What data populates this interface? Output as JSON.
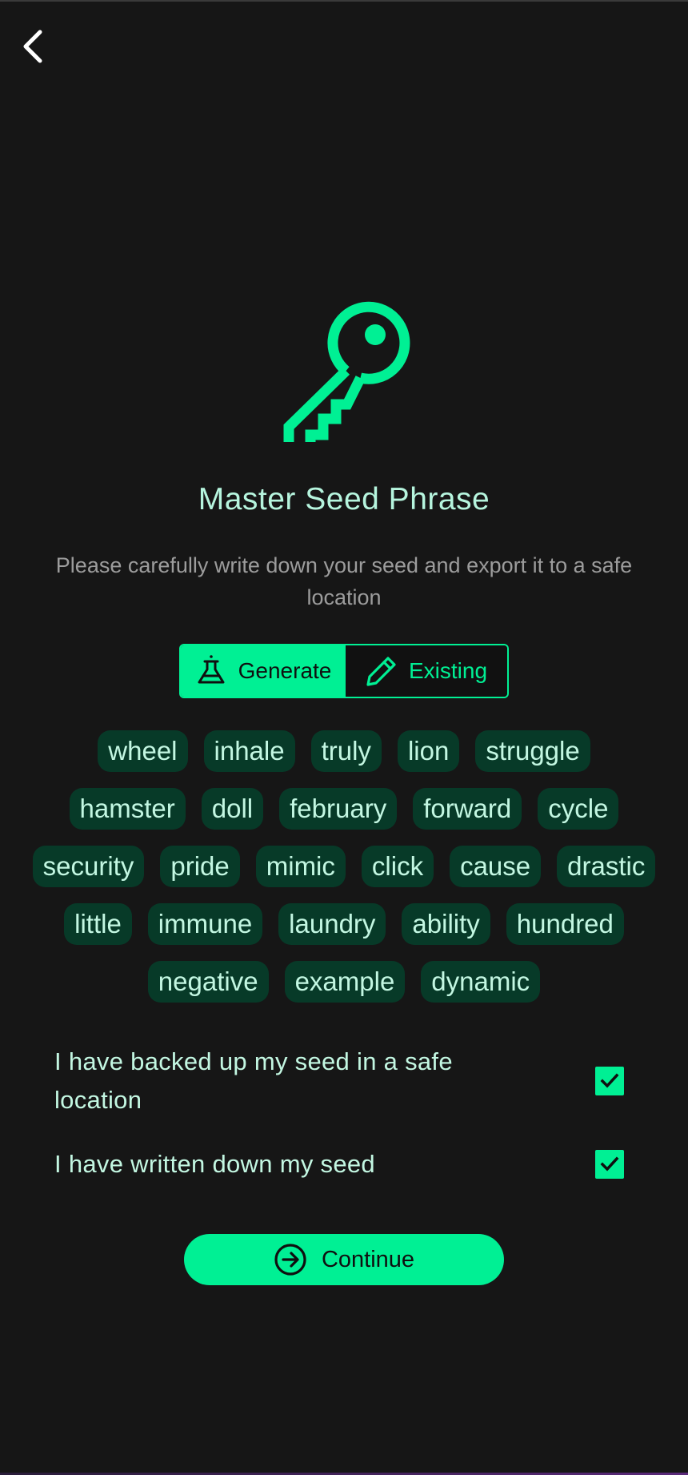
{
  "header": {
    "back_icon": "chevron-left-icon"
  },
  "hero": {
    "icon": "key-icon",
    "title": "Master Seed Phrase",
    "subtitle": "Please carefully write down your seed and export it to a safe location"
  },
  "mode_toggle": {
    "selected": "Generate",
    "options": [
      {
        "label": "Generate",
        "icon": "flask-icon"
      },
      {
        "label": "Existing",
        "icon": "pencil-icon"
      }
    ]
  },
  "seed_words": [
    "wheel",
    "inhale",
    "truly",
    "lion",
    "struggle",
    "hamster",
    "doll",
    "february",
    "forward",
    "cycle",
    "security",
    "pride",
    "mimic",
    "click",
    "cause",
    "drastic",
    "little",
    "immune",
    "laundry",
    "ability",
    "hundred",
    "negative",
    "example",
    "dynamic"
  ],
  "confirmations": [
    {
      "label": "I have backed up my seed in a safe location",
      "checked": true
    },
    {
      "label": "I have written down my seed",
      "checked": true
    }
  ],
  "continue_button": {
    "label": "Continue",
    "icon": "arrow-right-circle-icon"
  },
  "colors": {
    "background": "#161616",
    "accent": "#00f094",
    "chip_background": "#073a28",
    "text_light": "#c3f7e2",
    "muted": "#9c9c9c"
  }
}
